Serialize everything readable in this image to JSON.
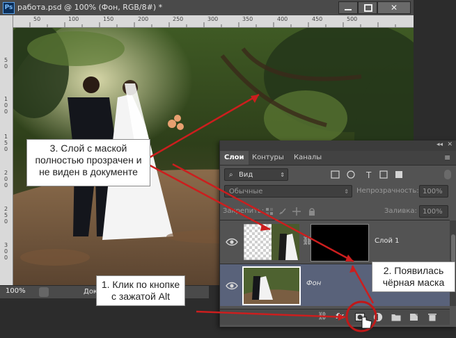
{
  "window": {
    "title": "работа.psd @ 100% (Фон, RGB/8#) *",
    "app_icon": "Ps",
    "close_glyph": "✕"
  },
  "ruler": {
    "top_ticks": [
      "50",
      "100",
      "150",
      "200",
      "250",
      "300",
      "350",
      "400",
      "450",
      "500"
    ],
    "left_ticks": [
      "5",
      "0",
      "1",
      "0",
      "0",
      "1",
      "5",
      "0",
      "2",
      "0",
      "0",
      "2",
      "5",
      "0",
      "3",
      "0",
      "0",
      "3",
      "5",
      "0"
    ]
  },
  "status": {
    "zoom": "100%",
    "doc_info": "Док"
  },
  "panel": {
    "collapse_glyph": "◂◂",
    "close_glyph": "✕",
    "tabs": [
      "Слои",
      "Контуры",
      "Каналы"
    ],
    "kind_filter": "Вид",
    "blend_mode": "Обычные",
    "opacity_label": "Непрозрачность:",
    "opacity_value": "100%",
    "lock_label": "Закрепить:",
    "fill_label": "Заливка:",
    "fill_value": "100%",
    "layers": [
      {
        "name": "Слой 1",
        "italic": false
      },
      {
        "name": "Фон",
        "italic": true
      }
    ]
  },
  "callouts": {
    "c1": "1. Клик по кнопке с зажатой Alt",
    "c2": "2. Появилась чёрная маска",
    "c3": "3. Слой с маской полностью прозрачен и не виден в документе"
  },
  "colors": {
    "arrow": "#cc1e1e",
    "panel_bg": "#535353",
    "selected_row": "#59627a"
  }
}
